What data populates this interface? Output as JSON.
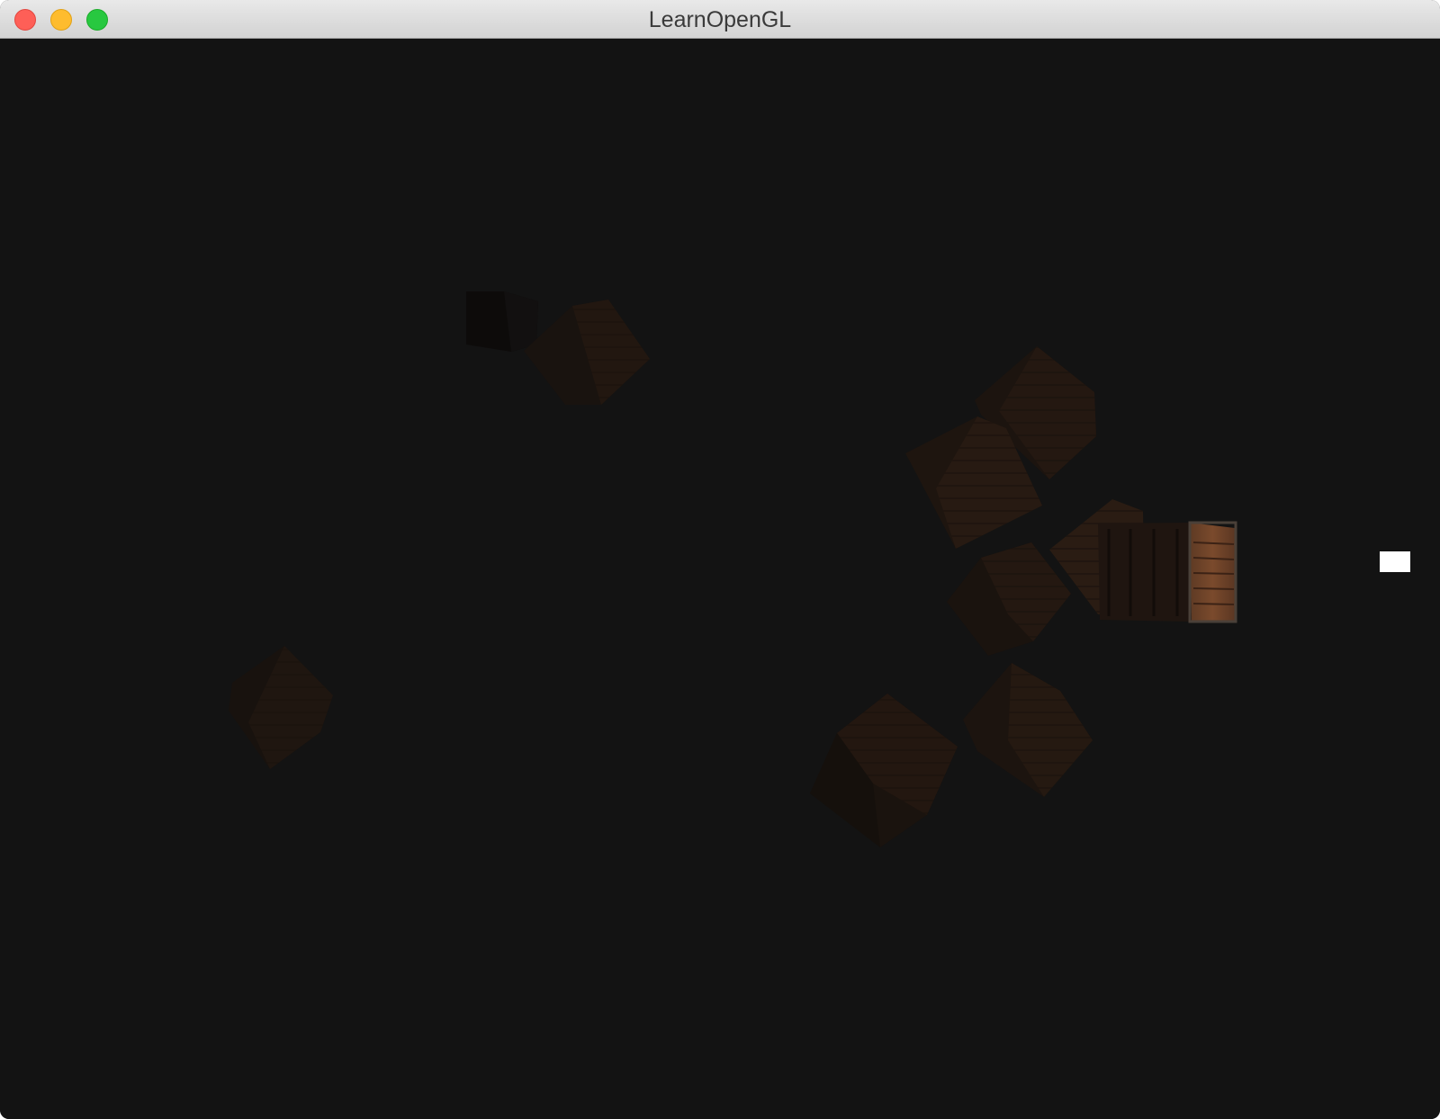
{
  "window": {
    "title": "LearnOpenGL",
    "controls": {
      "close": "close-icon",
      "minimize": "minimize-icon",
      "zoom": "zoom-icon"
    }
  },
  "scene": {
    "background_color": "#131313",
    "light_color": "#ffffff",
    "crate_color": "#2a1c14",
    "crate_count": 11,
    "light_source_count": 1
  }
}
